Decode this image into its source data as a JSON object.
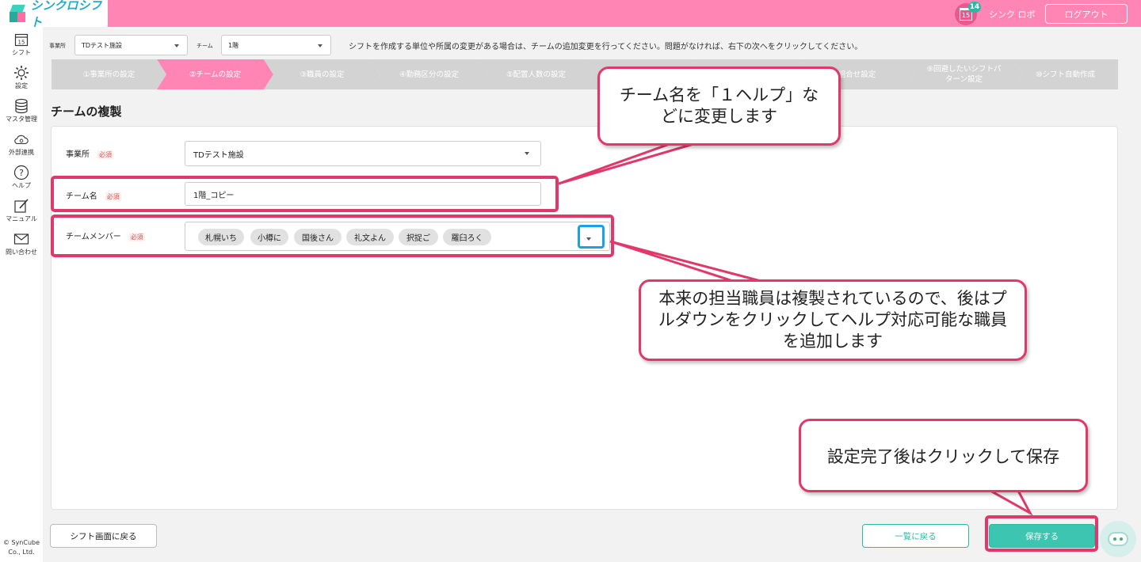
{
  "header": {
    "logo_text": "シンクロシフト",
    "calendar_day": "15",
    "notification_count": "14",
    "user_name": "シンク ロボ",
    "logout_label": "ログアウト"
  },
  "sidebar": {
    "items": [
      {
        "label": "シフト",
        "icon": "calendar-icon",
        "glyph": "15"
      },
      {
        "label": "設定",
        "icon": "gear-icon"
      },
      {
        "label": "マスタ管理",
        "icon": "database-icon"
      },
      {
        "label": "外部連携",
        "icon": "cloud-icon"
      },
      {
        "label": "ヘルプ",
        "icon": "help-icon",
        "glyph": "?"
      },
      {
        "label": "マニュアル",
        "icon": "edit-icon"
      },
      {
        "label": "問い合わせ",
        "icon": "mail-icon"
      }
    ],
    "copyright": "© SynCube Co., Ltd."
  },
  "filters": {
    "office_label": "事業所",
    "office_value": "TDテスト施設",
    "team_label": "チーム",
    "team_value": "1階",
    "notice": "シフトを作成する単位や所属の変更がある場合は、チームの追加変更を行ってください。問題がなければ、右下の次へをクリックしてください。"
  },
  "steps": [
    {
      "label": "①事業所の設定",
      "active": false
    },
    {
      "label": "②チームの設定",
      "active": true
    },
    {
      "label": "③職員の設定",
      "active": false
    },
    {
      "label": "④勤務区分の設定",
      "active": false
    },
    {
      "label": "⑤配置人数の設定",
      "active": false
    },
    {
      "label": "",
      "active": false
    },
    {
      "label": "",
      "active": false
    },
    {
      "label": "組合せ設定",
      "active": false
    },
    {
      "label": "⑨回避したいシフトパターン設定",
      "active": false
    },
    {
      "label": "⑩シフト自動作成",
      "active": false
    }
  ],
  "page_title": "チームの複製",
  "form": {
    "office_label": "事業所",
    "office_value": "TDテスト施設",
    "team_name_label": "チーム名",
    "team_name_value": "1階_コピー",
    "members_label": "チームメンバー",
    "required": "必須",
    "members": [
      "札幌いち",
      "小樽に",
      "国後さん",
      "礼文よん",
      "択捉ご",
      "羅臼ろく"
    ]
  },
  "buttons": {
    "back_to_shift": "シフト画面に戻る",
    "back_to_list": "一覧に戻る",
    "save": "保存する"
  },
  "callouts": {
    "rename": "チーム名を「１ヘルプ」などに変更します",
    "members": "本来の担当職員は複製されているので、後はプルダウンをクリックしてヘルプ対応可能な職員を追加します",
    "save": "設定完了後はクリックして保存"
  },
  "colors": {
    "brand_pink": "#ff86b4",
    "accent_teal": "#2bb8a4",
    "highlight": "#e0386a",
    "focus_blue": "#1aa1e8"
  }
}
